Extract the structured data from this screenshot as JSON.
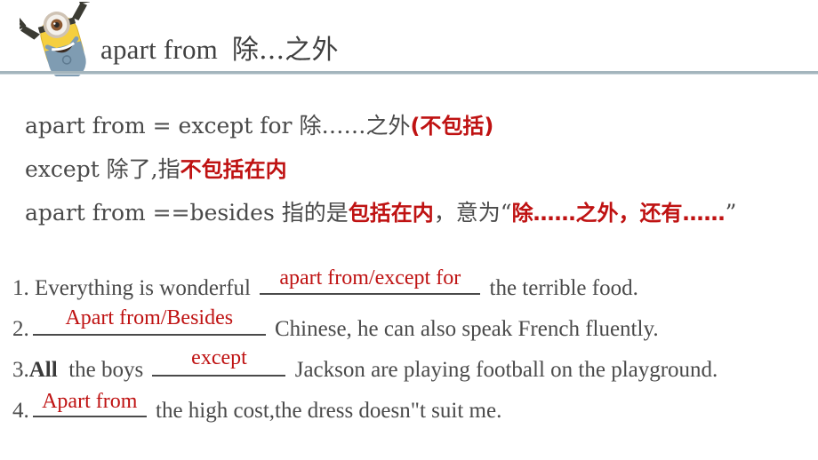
{
  "header": {
    "title_en": "apart from",
    "title_cn": "除...之外",
    "mascot_icon": "minion-character-icon",
    "rule_color": "#a4b5bd"
  },
  "colors": {
    "text": "#4a4a4a",
    "accent_red": "#bf1212",
    "title": "#404040",
    "rule": "#a4b5bd"
  },
  "definitions": [
    {
      "id": "def-1",
      "plain_1": "apart from = except for  除……之外",
      "red_1": "(不包括)"
    },
    {
      "id": "def-2",
      "plain_1": "except  除了,指",
      "red_1": "不包括在内"
    },
    {
      "id": "def-3",
      "plain_1": "apart from ==besides 指的是",
      "red_1": "包括在内",
      "plain_2": "，意为",
      "quote_open": "“",
      "red_2": "除……之外，还有……",
      "quote_close": "”"
    }
  ],
  "exercises": [
    {
      "number": "1.",
      "before": "Everything is wonderful",
      "answer": "apart from/except for",
      "after": "the terrible food."
    },
    {
      "number": "2.",
      "before": "",
      "answer": "Apart from/Besides",
      "after": "Chinese, he can also speak French fluently."
    },
    {
      "number": "3.",
      "bold_word": "All",
      "before": "the boys",
      "answer": "except",
      "after": "Jackson are playing football on the playground."
    },
    {
      "number": "4.",
      "before": "",
      "answer": "Apart from",
      "after": "the high cost,the dress doesn\"t suit me."
    }
  ]
}
